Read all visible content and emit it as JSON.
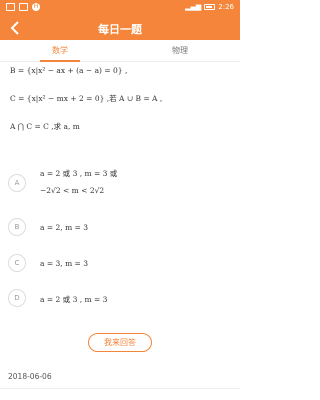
{
  "status_bar": {
    "left_badge": "H",
    "time": "2:26"
  },
  "header": {
    "title": "每日一题",
    "back_icon": "chevron-left-icon"
  },
  "tabs": [
    {
      "label": "数学",
      "active": true
    },
    {
      "label": "物理",
      "active": false
    }
  ],
  "question": {
    "line1": "B = {x|x² − ax + (a − a) = 0} ,",
    "line2": "C = {x|x² − mx + 2 = 0} ,若 A ∪ B = A ,",
    "line3": "A ⋂ C = C ,求 a, m"
  },
  "options": [
    {
      "letter": "A",
      "line1": "a = 2 或 3 ,   m = 3 或",
      "line2": "−2√2 < m < 2√2"
    },
    {
      "letter": "B",
      "line1": "a = 2, m = 3"
    },
    {
      "letter": "C",
      "line1": "a = 3, m = 3"
    },
    {
      "letter": "D",
      "line1": "a = 2 或 3 , m = 3"
    }
  ],
  "answer_button": "我来回答",
  "date": "2018-06-06",
  "colors": {
    "accent": "#f5853a"
  }
}
